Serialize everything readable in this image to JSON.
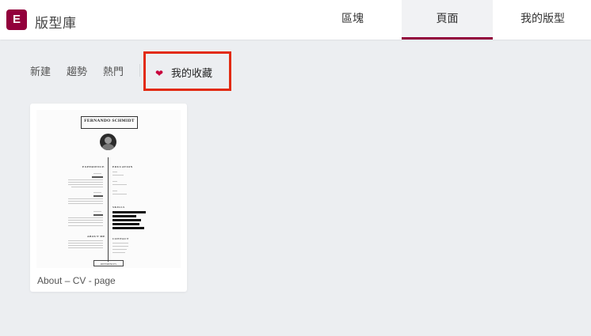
{
  "header": {
    "logo_glyph": "E",
    "title": "版型庫",
    "tabs": [
      {
        "label": "區塊",
        "active": false
      },
      {
        "label": "頁面",
        "active": true
      },
      {
        "label": "我的版型",
        "active": false
      }
    ],
    "accent_color": "#92003b"
  },
  "filters": {
    "items": [
      "新建",
      "趨勢",
      "熱門"
    ],
    "favorites": {
      "label": "我的收藏",
      "icon": "heart-icon",
      "highlight_color": "#e22a10"
    }
  },
  "templates": [
    {
      "label": "About – CV - page",
      "preview": {
        "name": "FERNANDO SCHMIDT",
        "sections": [
          "EXPERIENCE",
          "EDUCATION",
          "SKILLS",
          "ABOUT ME",
          "CONTACT"
        ],
        "references_label": "REFERENCES"
      }
    }
  ]
}
